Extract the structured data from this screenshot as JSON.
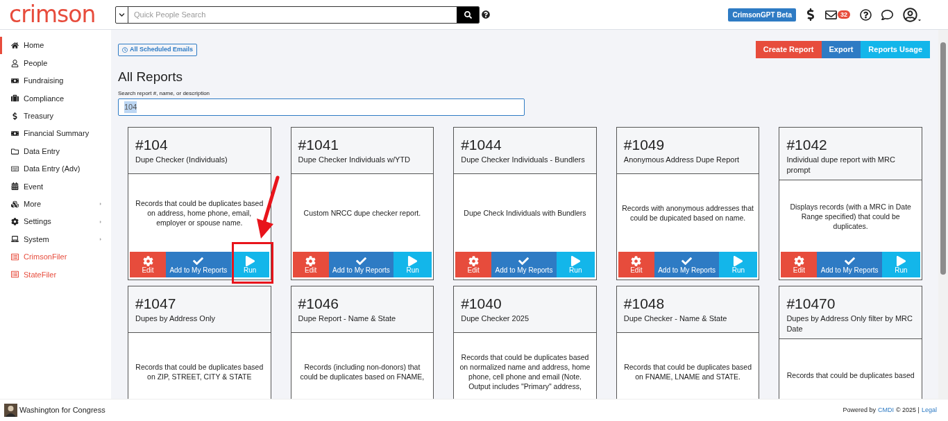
{
  "header": {
    "logo": "crimson",
    "search": {
      "placeholder": "Quick People Search"
    },
    "gpt_button": "CrimsonGPT Beta",
    "mail_badge": "32"
  },
  "sidebar": {
    "items": [
      {
        "label": "Home",
        "selected": true,
        "submenu": false,
        "kind": "nav"
      },
      {
        "label": "People",
        "selected": false,
        "submenu": false,
        "kind": "nav"
      },
      {
        "label": "Fundraising",
        "selected": false,
        "submenu": false,
        "kind": "nav"
      },
      {
        "label": "Compliance",
        "selected": false,
        "submenu": false,
        "kind": "nav"
      },
      {
        "label": "Treasury",
        "selected": false,
        "submenu": false,
        "kind": "nav"
      },
      {
        "label": "Financial Summary",
        "selected": false,
        "submenu": false,
        "kind": "nav"
      },
      {
        "label": "Data Entry",
        "selected": false,
        "submenu": false,
        "kind": "nav"
      },
      {
        "label": "Data Entry (Adv)",
        "selected": false,
        "submenu": false,
        "kind": "nav"
      },
      {
        "label": "Event",
        "selected": false,
        "submenu": false,
        "kind": "nav"
      },
      {
        "label": "More",
        "selected": false,
        "submenu": true,
        "kind": "nav"
      },
      {
        "label": "Settings",
        "selected": false,
        "submenu": true,
        "kind": "nav"
      },
      {
        "label": "System",
        "selected": false,
        "submenu": true,
        "kind": "nav"
      },
      {
        "label": "CrimsonFiler",
        "selected": false,
        "submenu": false,
        "kind": "filer"
      },
      {
        "label": "StateFiler",
        "selected": false,
        "submenu": false,
        "kind": "filer"
      }
    ]
  },
  "toolbar": {
    "scheduled_button": "All Scheduled Emails",
    "actions": [
      "Create Report",
      "Export",
      "Reports Usage"
    ]
  },
  "title": "All Reports",
  "search": {
    "label": "Search report #, name, or description",
    "value": "104"
  },
  "reports": [
    {
      "number": "#104",
      "name": "Dupe Checker (Individuals)",
      "description": "Records that could be duplicates based on address, home phone, email, employer or spouse name.",
      "highlighted": true,
      "buttons": [
        "Edit",
        "Add to My Reports",
        "Run"
      ]
    },
    {
      "number": "#1041",
      "name": "Dupe Checker Individuals w/YTD",
      "description": "Custom NRCC dupe checker report.",
      "highlighted": false,
      "buttons": [
        "Edit",
        "Add to My Reports",
        "Run"
      ]
    },
    {
      "number": "#1044",
      "name": "Dupe Checker Individuals - Bundlers",
      "description": "Dupe Check Individuals with Bundlers",
      "highlighted": false,
      "buttons": [
        "Edit",
        "Add to My Reports",
        "Run"
      ]
    },
    {
      "number": "#1049",
      "name": "Anonymous Address Dupe Report",
      "description": "Records with anonymous addresses that could be dupicated based on name.",
      "highlighted": false,
      "buttons": [
        "Edit",
        "Add to My Reports",
        "Run"
      ]
    },
    {
      "number": "#1042",
      "name": "Individual dupe report with MRC prompt",
      "description": "Displays records (with a MRC in Date Range specified) that could be duplicates.",
      "highlighted": false,
      "buttons": [
        "Edit",
        "Add to My Reports",
        "Run"
      ]
    },
    {
      "number": "#1047",
      "name": "Dupes by Address Only",
      "description": "Records that could be duplicates based on ZIP, STREET, CITY & STATE",
      "highlighted": false
    },
    {
      "number": "#1046",
      "name": "Dupe Report - Name & State",
      "description": "Records (including non-donors) that could be duplicates based on FNAME,",
      "highlighted": false
    },
    {
      "number": "#1040",
      "name": "Dupe Checker 2025",
      "description": "Records that could be duplicates based on normalized name and address, home phone, cell phone and email (Note. Output includes \"Primary\" address,",
      "highlighted": false
    },
    {
      "number": "#1048",
      "name": "Dupe Checker - Name & State",
      "description": "Records that could be duplicates based on FNAME, LNAME and STATE.",
      "highlighted": false
    },
    {
      "number": "#10470",
      "name": "Dupes by Address Only filter by MRC Date",
      "description": "Records that could be duplicates based",
      "highlighted": false
    }
  ],
  "footer": {
    "organization": "Washington for Congress",
    "powered_by": "Powered by",
    "vendor": "CMDI",
    "copyright": "© 2025 |",
    "legal": "Legal"
  }
}
